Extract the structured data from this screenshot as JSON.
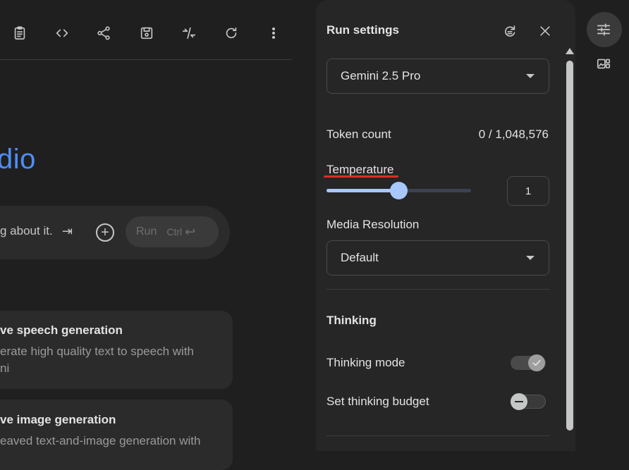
{
  "main": {
    "title_partial": "dio",
    "prompt_placeholder_partial": "g about it.",
    "run_label": "Run",
    "run_shortcut": "Ctrl",
    "cards": [
      {
        "title": "ve speech generation",
        "desc_line1": "erate high quality text to speech with",
        "desc_line2": "ni"
      },
      {
        "title": "ve image generation",
        "desc_line1": "eaved text-and-image generation with"
      }
    ]
  },
  "toolbar": {
    "icons": [
      "clipboard-icon",
      "code-icon",
      "share-icon",
      "save-icon",
      "compare-icon",
      "refresh-icon",
      "more-vert-icon"
    ]
  },
  "run_settings": {
    "title": "Run settings",
    "model": "Gemini 2.5 Pro",
    "token_count_label": "Token count",
    "token_count_value": "0 / 1,048,576",
    "temperature_label": "Temperature",
    "temperature_value": "1",
    "temperature_fraction": 0.5,
    "media_resolution_label": "Media Resolution",
    "media_resolution_value": "Default",
    "thinking_heading": "Thinking",
    "thinking_mode_label": "Thinking mode",
    "thinking_mode_on": true,
    "thinking_budget_label": "Set thinking budget",
    "thinking_budget_on": false
  },
  "colors": {
    "accent_blue": "#4f8ef7",
    "slider": "#a8c7fa",
    "underline_red": "#d93025"
  }
}
